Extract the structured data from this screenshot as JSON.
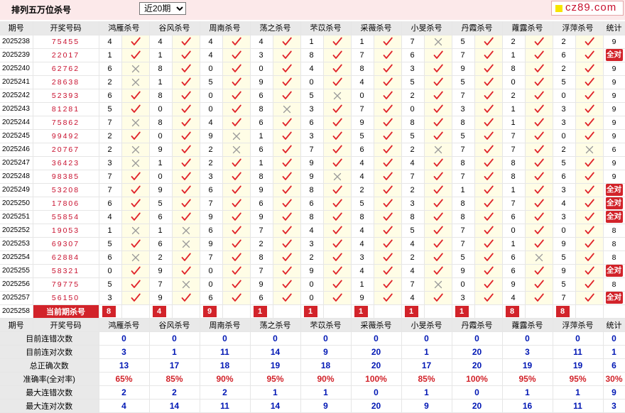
{
  "header": {
    "title": "排列五万位杀号",
    "period_select": {
      "selected": "近20期",
      "options": [
        "近20期"
      ]
    },
    "logo_text": "cz89.com"
  },
  "columns": {
    "issue": "期号",
    "draw": "开奖号码",
    "methods": [
      "鸿雁杀号",
      "谷风杀号",
      "周南杀号",
      "荡之杀号",
      "芣苡杀号",
      "采薇杀号",
      "小旻杀号",
      "丹霞杀号",
      "蕹露杀号",
      "浮萍杀号"
    ],
    "stat": "统计"
  },
  "rows": [
    {
      "issue": "2025238",
      "draw": "75455",
      "kills": [
        4,
        4,
        4,
        4,
        1,
        1,
        7,
        5,
        2,
        2
      ],
      "hits": [
        1,
        1,
        1,
        1,
        1,
        1,
        0,
        1,
        1,
        1
      ],
      "stat": "9"
    },
    {
      "issue": "2025239",
      "draw": "22017",
      "kills": [
        1,
        1,
        4,
        3,
        8,
        7,
        6,
        7,
        1,
        6
      ],
      "hits": [
        1,
        1,
        1,
        1,
        1,
        1,
        1,
        1,
        1,
        1
      ],
      "stat": "全对"
    },
    {
      "issue": "2025240",
      "draw": "62762",
      "kills": [
        6,
        8,
        0,
        0,
        4,
        8,
        3,
        9,
        8,
        2
      ],
      "hits": [
        0,
        1,
        1,
        1,
        1,
        1,
        1,
        1,
        1,
        1
      ],
      "stat": "9"
    },
    {
      "issue": "2025241",
      "draw": "28638",
      "kills": [
        2,
        1,
        5,
        9,
        0,
        4,
        5,
        5,
        0,
        5
      ],
      "hits": [
        0,
        1,
        1,
        1,
        1,
        1,
        1,
        1,
        1,
        1
      ],
      "stat": "9"
    },
    {
      "issue": "2025242",
      "draw": "52393",
      "kills": [
        6,
        8,
        0,
        6,
        5,
        0,
        2,
        7,
        2,
        0
      ],
      "hits": [
        1,
        1,
        1,
        1,
        0,
        1,
        1,
        1,
        1,
        1
      ],
      "stat": "9"
    },
    {
      "issue": "2025243",
      "draw": "81281",
      "kills": [
        5,
        0,
        0,
        8,
        3,
        7,
        0,
        3,
        1,
        3
      ],
      "hits": [
        1,
        1,
        1,
        0,
        1,
        1,
        1,
        1,
        1,
        1
      ],
      "stat": "9"
    },
    {
      "issue": "2025244",
      "draw": "75862",
      "kills": [
        7,
        8,
        4,
        6,
        6,
        9,
        8,
        8,
        1,
        3
      ],
      "hits": [
        0,
        1,
        1,
        1,
        1,
        1,
        1,
        1,
        1,
        1
      ],
      "stat": "9"
    },
    {
      "issue": "2025245",
      "draw": "99492",
      "kills": [
        2,
        0,
        9,
        1,
        3,
        5,
        5,
        5,
        7,
        0
      ],
      "hits": [
        1,
        1,
        0,
        1,
        1,
        1,
        1,
        1,
        1,
        1
      ],
      "stat": "9"
    },
    {
      "issue": "2025246",
      "draw": "20767",
      "kills": [
        2,
        9,
        2,
        6,
        7,
        6,
        2,
        7,
        7,
        2
      ],
      "hits": [
        0,
        1,
        0,
        1,
        1,
        1,
        0,
        1,
        1,
        0
      ],
      "stat": "6"
    },
    {
      "issue": "2025247",
      "draw": "36423",
      "kills": [
        3,
        1,
        2,
        1,
        9,
        4,
        4,
        8,
        8,
        5
      ],
      "hits": [
        0,
        1,
        1,
        1,
        1,
        1,
        1,
        1,
        1,
        1
      ],
      "stat": "9"
    },
    {
      "issue": "2025248",
      "draw": "98385",
      "kills": [
        7,
        0,
        3,
        8,
        9,
        4,
        7,
        7,
        8,
        6
      ],
      "hits": [
        1,
        1,
        1,
        1,
        0,
        1,
        1,
        1,
        1,
        1
      ],
      "stat": "9"
    },
    {
      "issue": "2025249",
      "draw": "53208",
      "kills": [
        7,
        9,
        6,
        9,
        8,
        2,
        2,
        1,
        1,
        3
      ],
      "hits": [
        1,
        1,
        1,
        1,
        1,
        1,
        1,
        1,
        1,
        1
      ],
      "stat": "全对"
    },
    {
      "issue": "2025250",
      "draw": "17806",
      "kills": [
        6,
        5,
        7,
        6,
        6,
        5,
        3,
        8,
        7,
        4
      ],
      "hits": [
        1,
        1,
        1,
        1,
        1,
        1,
        1,
        1,
        1,
        1
      ],
      "stat": "全对"
    },
    {
      "issue": "2025251",
      "draw": "55854",
      "kills": [
        4,
        6,
        9,
        9,
        8,
        8,
        8,
        8,
        6,
        3
      ],
      "hits": [
        1,
        1,
        1,
        1,
        1,
        1,
        1,
        1,
        1,
        1
      ],
      "stat": "全对"
    },
    {
      "issue": "2025252",
      "draw": "19053",
      "kills": [
        1,
        1,
        6,
        7,
        4,
        4,
        5,
        7,
        0,
        0
      ],
      "hits": [
        0,
        0,
        1,
        1,
        1,
        1,
        1,
        1,
        1,
        1
      ],
      "stat": "8"
    },
    {
      "issue": "2025253",
      "draw": "69307",
      "kills": [
        5,
        6,
        9,
        2,
        3,
        4,
        4,
        7,
        1,
        9
      ],
      "hits": [
        1,
        0,
        1,
        1,
        1,
        1,
        1,
        1,
        1,
        1
      ],
      "stat": "8"
    },
    {
      "issue": "2025254",
      "draw": "62884",
      "kills": [
        6,
        2,
        7,
        8,
        2,
        3,
        2,
        5,
        6,
        5
      ],
      "hits": [
        0,
        1,
        1,
        1,
        1,
        1,
        1,
        1,
        0,
        1
      ],
      "stat": "8"
    },
    {
      "issue": "2025255",
      "draw": "58321",
      "kills": [
        0,
        9,
        0,
        7,
        9,
        4,
        4,
        9,
        6,
        9
      ],
      "hits": [
        1,
        1,
        1,
        1,
        1,
        1,
        1,
        1,
        1,
        1
      ],
      "stat": "全对"
    },
    {
      "issue": "2025256",
      "draw": "79775",
      "kills": [
        5,
        7,
        0,
        9,
        0,
        1,
        7,
        0,
        9,
        5
      ],
      "hits": [
        1,
        0,
        1,
        1,
        1,
        1,
        0,
        1,
        1,
        1
      ],
      "stat": "8"
    },
    {
      "issue": "2025257",
      "draw": "56150",
      "kills": [
        3,
        9,
        6,
        6,
        0,
        9,
        4,
        3,
        4,
        7
      ],
      "hits": [
        1,
        1,
        1,
        1,
        1,
        1,
        1,
        1,
        1,
        1
      ],
      "stat": "全对"
    }
  ],
  "current": {
    "issue": "2025258",
    "label": "当前期杀号",
    "kills": [
      "8",
      "4",
      "9",
      "1",
      "1",
      "1",
      "1",
      "1",
      "8",
      "8"
    ]
  },
  "summary": [
    {
      "label": "目前连错次数",
      "values": [
        "0",
        "0",
        "0",
        "0",
        "0",
        "0",
        "0",
        "0",
        "0",
        "0"
      ],
      "stat": "0"
    },
    {
      "label": "目前连对次数",
      "values": [
        "3",
        "1",
        "11",
        "14",
        "9",
        "20",
        "1",
        "20",
        "3",
        "11"
      ],
      "stat": "1"
    },
    {
      "label": "总正确次数",
      "values": [
        "13",
        "17",
        "18",
        "19",
        "18",
        "20",
        "17",
        "20",
        "19",
        "19"
      ],
      "stat": "6"
    },
    {
      "label": "准确率(全对率)",
      "values": [
        "65%",
        "85%",
        "90%",
        "95%",
        "90%",
        "100%",
        "85%",
        "100%",
        "95%",
        "95%"
      ],
      "stat": "30%",
      "rate": true
    },
    {
      "label": "最大连错次数",
      "values": [
        "2",
        "2",
        "2",
        "1",
        "1",
        "0",
        "1",
        "0",
        "1",
        "1"
      ],
      "stat": "9"
    },
    {
      "label": "最大连对次数",
      "values": [
        "4",
        "14",
        "11",
        "14",
        "9",
        "20",
        "9",
        "20",
        "16",
        "11"
      ],
      "stat": "3"
    }
  ],
  "icons": {
    "hit": "check-icon",
    "miss": "cross-icon"
  },
  "colors": {
    "accent_red": "#d2232a",
    "draw_red": "#c8102e",
    "summary_blue": "#0017b4",
    "check_red": "#e0242a",
    "cross_gray": "#9a9a9a",
    "header_gray": "#e9e9e9",
    "top_pink": "#fce9ea"
  }
}
